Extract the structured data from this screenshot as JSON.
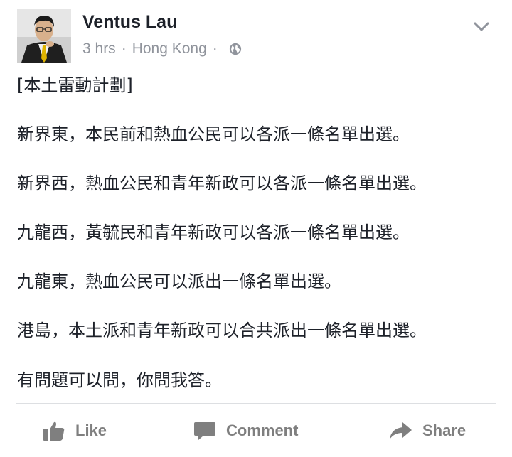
{
  "post": {
    "author": "Ventus Lau",
    "time": "3 hrs",
    "separator": "·",
    "location": "Hong Kong",
    "privacy_icon": "globe-icon",
    "menu_icon": "chevron-down-icon"
  },
  "content": {
    "tag": "[本土雷動計劃]",
    "lines": [
      "新界東，本民前和熱血公民可以各派一條名單出選。",
      "新界西，熱血公民和青年新政可以各派一條名單出選。",
      "九龍西，黃毓民和青年新政可以各派一條名單出選。",
      "九龍東，熱血公民可以派出一條名單出選。",
      "港島，本土派和青年新政可以合共派出一條名單出選。",
      "有問題可以問，你問我答。"
    ]
  },
  "actions": {
    "like": "Like",
    "comment": "Comment",
    "share": "Share"
  },
  "colors": {
    "name": "#1d2129",
    "meta": "#90949c",
    "action": "#7f7f7f",
    "divider": "#dddfe2"
  }
}
